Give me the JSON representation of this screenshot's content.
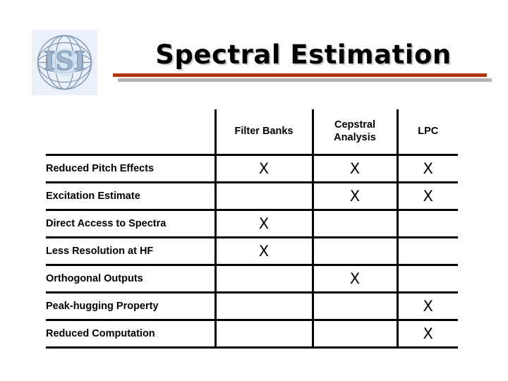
{
  "slide": {
    "title": "Spectral Estimation",
    "logo_alt": "isi-globe-logo",
    "logo_letters": "ISI",
    "accent_color": "#b2360f",
    "accent_shadow_color": "#b3b3b3",
    "logo_background": "#e9f0fa"
  },
  "table": {
    "corner_header": "",
    "columns": [
      "Filter Banks",
      "Cepstral Analysis",
      "LPC"
    ],
    "column_lines": [
      [
        "Filter",
        "Banks"
      ],
      [
        "Cepstral",
        "Analysis"
      ],
      [
        "LPC"
      ]
    ],
    "mark": "X",
    "rows": [
      {
        "label": "Reduced Pitch Effects",
        "marks": [
          "X",
          "X",
          "X"
        ]
      },
      {
        "label": "Excitation Estimate",
        "marks": [
          "",
          "X",
          "X"
        ]
      },
      {
        "label": "Direct Access to Spectra",
        "marks": [
          "X",
          "",
          ""
        ]
      },
      {
        "label": "Less Resolution at HF",
        "marks": [
          "X",
          "",
          ""
        ]
      },
      {
        "label": "Orthogonal Outputs",
        "marks": [
          "",
          "X",
          ""
        ]
      },
      {
        "label": "Peak-hugging Property",
        "marks": [
          "",
          "",
          "X"
        ]
      },
      {
        "label": "Reduced Computation",
        "marks": [
          "",
          "",
          "X"
        ]
      }
    ]
  }
}
